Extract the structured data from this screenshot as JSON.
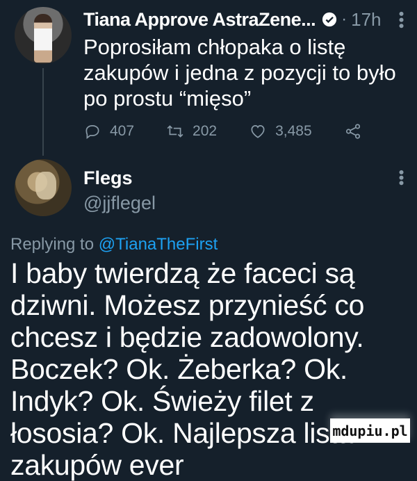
{
  "tweet1": {
    "display_name": "Tiana Approve AstraZene...",
    "separator": "·",
    "time": "17h",
    "text": "Poprosiłam chłopaka o listę zakupów i jedna z pozycji to było po prostu “mięso”",
    "replies": "407",
    "retweets": "202",
    "likes": "3,485"
  },
  "tweet2": {
    "display_name": "Flegs",
    "handle": "@jjflegel",
    "replying_prefix": "Replying to",
    "replying_mention": "@TianaTheFirst",
    "text": "I baby twierdzą że faceci są dziwni. Możesz przynieść co chcesz i będzie zadowolony. Boczek? Ok. Żeberka? Ok. Indyk? Ok. Świeży filet z łososia? Ok. Najlepsza lista zakupów ever"
  },
  "watermark": "mdupiu.pl",
  "colors": {
    "background": "#15202b",
    "secondary_text": "#8899a6",
    "accent": "#1da1f2"
  },
  "icons": [
    "verified-badge-icon",
    "more-icon",
    "reply-icon",
    "retweet-icon",
    "like-icon",
    "share-icon"
  ]
}
